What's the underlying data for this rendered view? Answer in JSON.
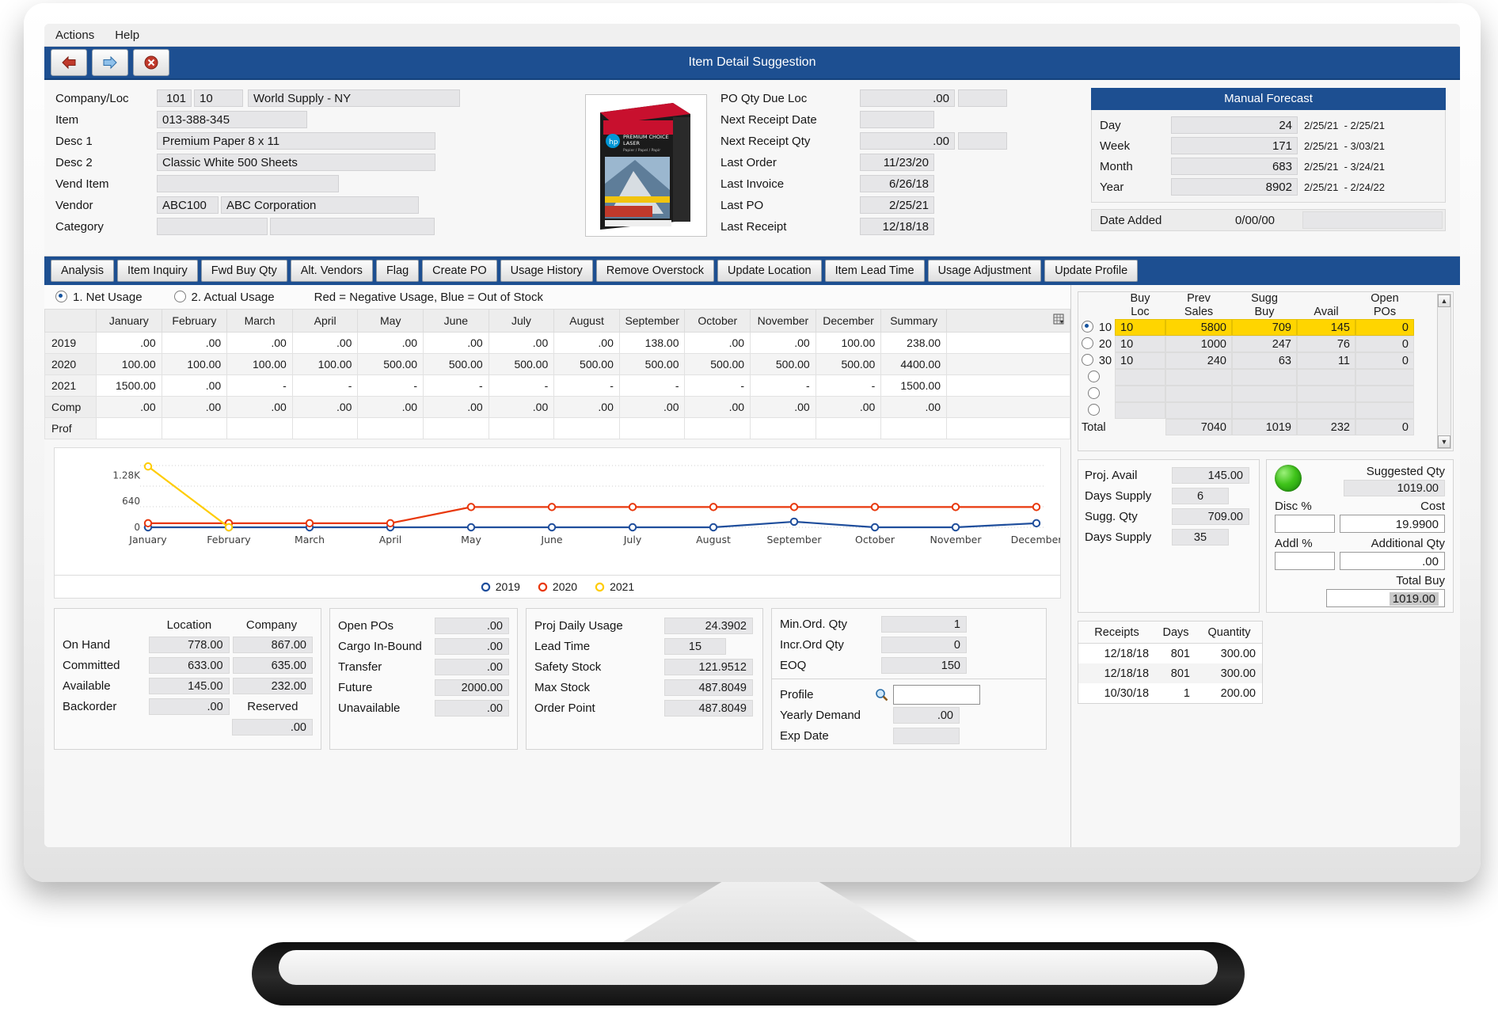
{
  "window": {
    "title": "Item Detail Suggestion",
    "menu": [
      "Actions",
      "Help"
    ],
    "nav": {
      "back": "back-arrow",
      "forward": "forward-arrow",
      "close": "close-x"
    }
  },
  "header": {
    "fields": [
      {
        "label": "Company/Loc",
        "company": "101",
        "loc": "10",
        "name": "World Supply - NY"
      },
      {
        "label": "Item",
        "value": "013-388-345"
      },
      {
        "label": "Desc 1",
        "value": "Premium Paper 8 x 11"
      },
      {
        "label": "Desc 2",
        "value": "Classic  White 500 Sheets"
      },
      {
        "label": "Vend Item",
        "value": ""
      },
      {
        "label": "Vendor",
        "code": "ABC100",
        "name": "ABC Corporation"
      },
      {
        "label": "Category",
        "code": "",
        "name": ""
      }
    ],
    "product_image": {
      "brand": "hp",
      "line1": "PREMIUM CHOICE",
      "line2": "LASER",
      "line3": "Papier / Papel / Papír"
    },
    "po_info": [
      {
        "label": "PO Qty Due Loc",
        "value": ".00"
      },
      {
        "label": "Next Receipt Date",
        "value": ""
      },
      {
        "label": "Next Receipt Qty",
        "value": ".00"
      },
      {
        "label": "Last Order",
        "value": "11/23/20"
      },
      {
        "label": "Last Invoice",
        "value": "6/26/18"
      },
      {
        "label": "Last PO",
        "value": "2/25/21"
      },
      {
        "label": "Last Receipt",
        "value": "12/18/18"
      }
    ],
    "manual_forecast": {
      "title": "Manual Forecast",
      "rows": [
        {
          "label": "Day",
          "value": "24",
          "from": "2/25/21",
          "dash": "-",
          "to": "2/25/21"
        },
        {
          "label": "Week",
          "value": "171",
          "from": "2/25/21",
          "dash": "-",
          "to": "3/03/21"
        },
        {
          "label": "Month",
          "value": "683",
          "from": "2/25/21",
          "dash": "-",
          "to": "3/24/21"
        },
        {
          "label": "Year",
          "value": "8902",
          "from": "2/25/21",
          "dash": "-",
          "to": "2/24/22"
        }
      ],
      "date_added_label": "Date Added",
      "date_added_value": "0/00/00"
    }
  },
  "tabs": [
    "Analysis",
    "Item Inquiry",
    "Fwd Buy Qty",
    "Alt. Vendors",
    "Flag",
    "Create PO",
    "Usage History",
    "Remove Overstock",
    "Update Location",
    "Item Lead Time",
    "Usage Adjustment",
    "Update Profile"
  ],
  "usage": {
    "option1": "1. Net Usage",
    "option2": "2. Actual Usage",
    "option_selected": 1,
    "legend_note": "Red = Negative Usage, Blue = Out of Stock",
    "grid_icon": "grid-settings-icon",
    "columns": [
      "",
      "January",
      "February",
      "March",
      "April",
      "May",
      "June",
      "July",
      "August",
      "September",
      "October",
      "November",
      "December",
      "Summary",
      ""
    ],
    "rows": [
      {
        "label": "2019",
        "cells": [
          ".00",
          ".00",
          ".00",
          ".00",
          ".00",
          ".00",
          ".00",
          ".00",
          "138.00",
          ".00",
          ".00",
          "100.00",
          "238.00",
          ""
        ]
      },
      {
        "label": "2020",
        "cells": [
          "100.00",
          "100.00",
          "100.00",
          "100.00",
          "500.00",
          "500.00",
          "500.00",
          "500.00",
          "500.00",
          "500.00",
          "500.00",
          "500.00",
          "4400.00",
          ""
        ]
      },
      {
        "label": "2021",
        "cells": [
          "1500.00",
          ".00",
          "-",
          "-",
          "-",
          "-",
          "-",
          "-",
          "-",
          "-",
          "-",
          "-",
          "1500.00",
          ""
        ]
      },
      {
        "label": "Comp",
        "cells": [
          ".00",
          ".00",
          ".00",
          ".00",
          ".00",
          ".00",
          ".00",
          ".00",
          ".00",
          ".00",
          ".00",
          ".00",
          ".00",
          ""
        ]
      },
      {
        "label": "Prof",
        "cells": [
          "",
          "",
          "",
          "",
          "",
          "",
          "",
          "",
          "",
          "",
          "",
          "",
          "",
          ""
        ]
      }
    ]
  },
  "chart_data": {
    "type": "line",
    "title": "",
    "xlabel": "",
    "ylabel": "",
    "categories": [
      "January",
      "February",
      "March",
      "April",
      "May",
      "June",
      "July",
      "August",
      "September",
      "October",
      "November",
      "December"
    ],
    "ytick_labels": [
      "0",
      "640",
      "1.28K"
    ],
    "ylim": [
      0,
      1600
    ],
    "grid": true,
    "legend_position": "bottom",
    "series": [
      {
        "name": "2019",
        "color": "#1f4e9c",
        "values": [
          0,
          0,
          0,
          0,
          0,
          0,
          0,
          0,
          138,
          0,
          0,
          100
        ]
      },
      {
        "name": "2020",
        "color": "#e8380d",
        "values": [
          100,
          100,
          100,
          100,
          500,
          500,
          500,
          500,
          500,
          500,
          500,
          500
        ]
      },
      {
        "name": "2021",
        "color": "#ffcc00",
        "values": [
          1500,
          0,
          null,
          null,
          null,
          null,
          null,
          null,
          null,
          null,
          null,
          null
        ]
      }
    ]
  },
  "inventory": {
    "col_location": "Location",
    "col_company": "Company",
    "rows": [
      {
        "label": "On Hand",
        "location": "778.00",
        "company": "867.00"
      },
      {
        "label": "Committed",
        "location": "633.00",
        "company": "635.00"
      },
      {
        "label": "Available",
        "location": "145.00",
        "company": "232.00"
      },
      {
        "label": "Backorder",
        "location": ".00",
        "company": "Reserved"
      }
    ],
    "reserved_value": ".00"
  },
  "po_card": [
    {
      "label": "Open POs",
      "value": ".00"
    },
    {
      "label": "Cargo In-Bound",
      "value": ".00"
    },
    {
      "label": "Transfer",
      "value": ".00"
    },
    {
      "label": "Future",
      "value": "2000.00"
    },
    {
      "label": "Unavailable",
      "value": ".00"
    }
  ],
  "planning_card": [
    {
      "label": "Proj Daily Usage",
      "value": "24.3902"
    },
    {
      "label": "Lead Time",
      "value": "15"
    },
    {
      "label": "Safety Stock",
      "value": "121.9512"
    },
    {
      "label": "Max Stock",
      "value": "487.8049"
    },
    {
      "label": "Order Point",
      "value": "487.8049"
    }
  ],
  "order_card": [
    {
      "label": "Min.Ord. Qty",
      "value": "1"
    },
    {
      "label": "Incr.Ord Qty",
      "value": "0"
    },
    {
      "label": "EOQ",
      "value": "150"
    }
  ],
  "profile_card": {
    "search_icon": "magnifier-icon",
    "rows": [
      {
        "label": "Profile",
        "value": ""
      },
      {
        "label": "Yearly Demand",
        "value": ".00"
      },
      {
        "label": "Exp Date",
        "value": ""
      }
    ]
  },
  "buy_grid": {
    "columns": [
      {
        "l1": "Buy",
        "l2": "Loc"
      },
      {
        "l1": "Prev",
        "l2": "Sales"
      },
      {
        "l1": "Sugg",
        "l2": "Buy"
      },
      {
        "l1": "",
        "l2": "Avail"
      },
      {
        "l1": "Open",
        "l2": "POs"
      }
    ],
    "rows": [
      {
        "radio": "10",
        "selected": true,
        "highlight": true,
        "cells": [
          "10",
          "5800",
          "709",
          "145",
          "0"
        ]
      },
      {
        "radio": "20",
        "selected": false,
        "highlight": false,
        "cells": [
          "10",
          "1000",
          "247",
          "76",
          "0"
        ]
      },
      {
        "radio": "30",
        "selected": false,
        "highlight": false,
        "cells": [
          "10",
          "240",
          "63",
          "11",
          "0"
        ]
      },
      {
        "radio": "",
        "selected": false,
        "highlight": false,
        "cells": [
          "",
          "",
          "",
          "",
          ""
        ]
      },
      {
        "radio": "",
        "selected": false,
        "highlight": false,
        "cells": [
          "",
          "",
          "",
          "",
          ""
        ]
      },
      {
        "radio": "",
        "selected": false,
        "highlight": false,
        "cells": [
          "",
          "",
          "",
          "",
          ""
        ]
      }
    ],
    "total_label": "Total",
    "total_cells": [
      "",
      "7040",
      "1019",
      "232",
      "0"
    ]
  },
  "summary": {
    "left_rows": [
      {
        "label": "Proj. Avail",
        "value": "145.00"
      },
      {
        "label": "Days Supply",
        "value": "6"
      },
      {
        "label": "Sugg. Qty",
        "value": "709.00"
      },
      {
        "label": "Days Supply",
        "value": "35"
      }
    ],
    "status_light": "green",
    "suggested_qty_label": "Suggested Qty",
    "suggested_qty_value": "1019.00",
    "disc_label": "Disc %",
    "disc_value": "",
    "cost_label": "Cost",
    "cost_value": "19.9900",
    "addl_label": "Addl %",
    "addl_value": "",
    "additional_qty_label": "Additional Qty",
    "additional_qty_value": ".00",
    "total_buy_label": "Total Buy",
    "total_buy_value": "1019.00"
  },
  "receipts": {
    "columns": [
      "Receipts",
      "Days",
      "Quantity"
    ],
    "rows": [
      [
        "12/18/18",
        "801",
        "300.00"
      ],
      [
        "12/18/18",
        "801",
        "300.00"
      ],
      [
        "10/30/18",
        "1",
        "200.00"
      ]
    ]
  }
}
